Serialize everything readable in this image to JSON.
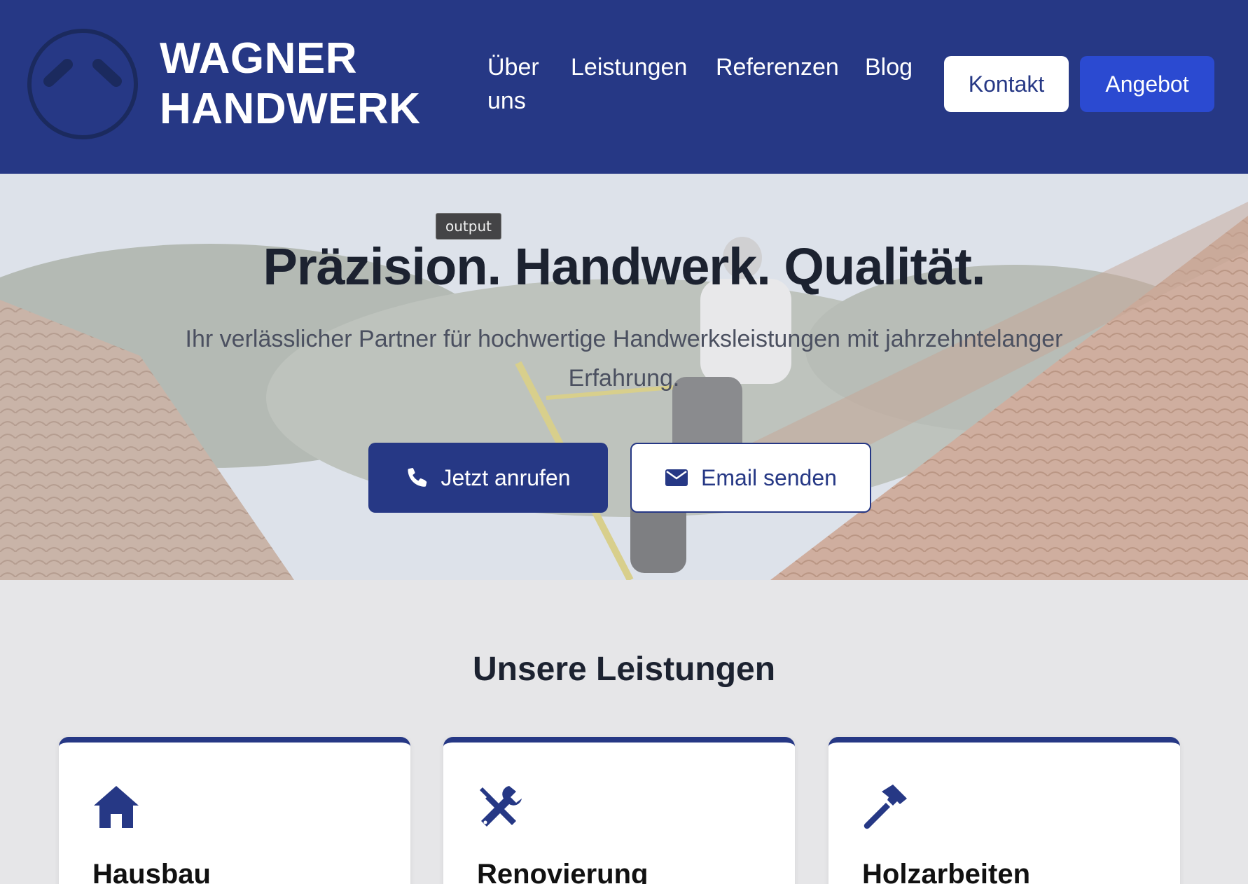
{
  "brand": {
    "line1": "WAGNER",
    "line2": "HANDWERK"
  },
  "nav": {
    "about": "Über uns",
    "services": "Leistungen",
    "references": "Referenzen",
    "blog": "Blog",
    "contact_button": "Kontakt",
    "quote_button": "Angebot"
  },
  "hero": {
    "tooltip": "output",
    "title": "Präzision. Handwerk. Qualität.",
    "subtitle": "Ihr verlässlicher Partner für hochwertige Handwerksleistungen mit jahrzehntelanger Erfahrung.",
    "call_button": "Jetzt anrufen",
    "call_icon": "phone-icon",
    "mail_button": "Email senden",
    "mail_icon": "envelope-icon"
  },
  "services": {
    "title": "Unsere Leistungen",
    "cards": [
      {
        "title": "Hausbau",
        "icon": "house-icon"
      },
      {
        "title": "Renovierung",
        "icon": "tools-icon"
      },
      {
        "title": "Holzarbeiten",
        "icon": "hammer-icon"
      }
    ]
  },
  "colors": {
    "primary": "#263885",
    "accent": "#2b4ad1",
    "text_dark": "#1c2230",
    "background": "#e6e6e8"
  }
}
